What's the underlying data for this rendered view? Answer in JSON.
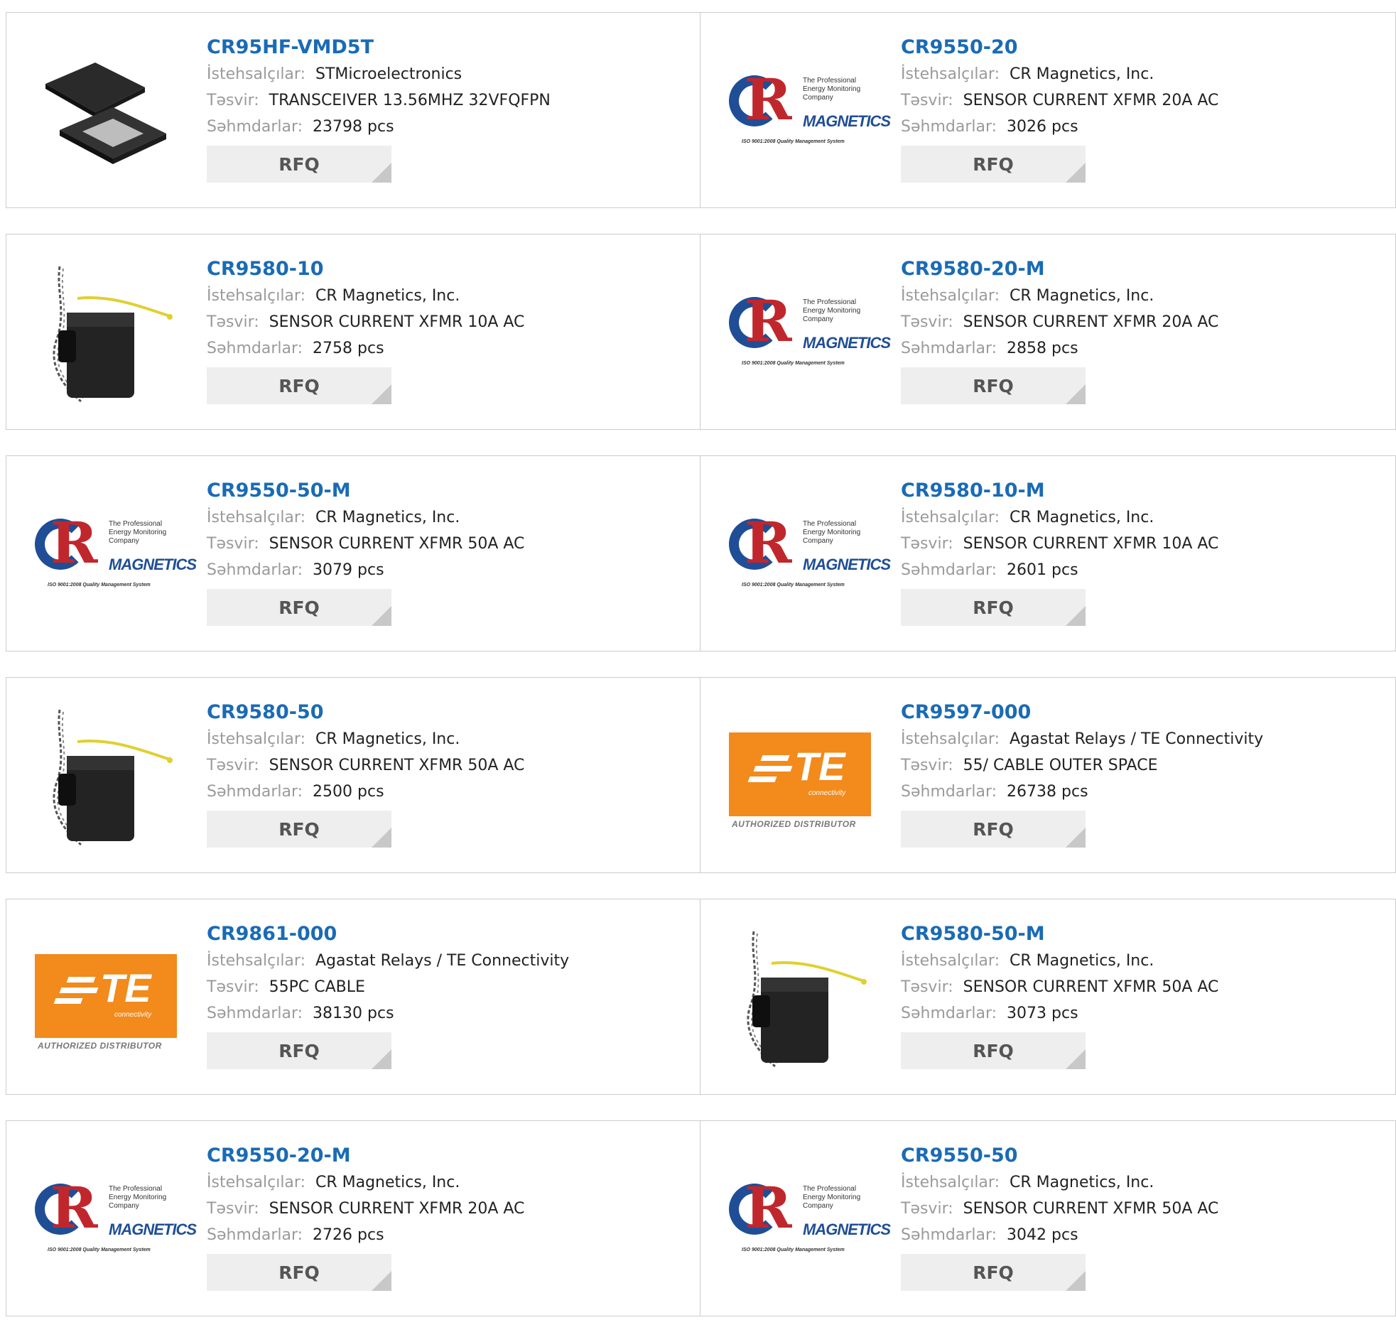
{
  "labels": {
    "manufacturer": "İstehsalçılar:",
    "description": "Təsvir:",
    "stock": "Səhmdarlar:",
    "rfq": "RFQ"
  },
  "logos": {
    "cr": {
      "tagline": "The Professional Energy Monitoring Company",
      "brand": "MAGNETICS",
      "iso": "ISO 9001:2008 Quality Management System"
    },
    "te": {
      "brand": "TE",
      "sub": "connectivity",
      "auth": "AUTHORIZED DISTRIBUTOR"
    }
  },
  "colors": {
    "part_link": "#1a6bb5",
    "label": "#9a9a9a",
    "rfq_bg": "#eeeeee",
    "te_orange": "#f28a1c"
  },
  "products": [
    {
      "part": "CR95HF-VMD5T",
      "manufacturer": "STMicroelectronics",
      "description": "TRANSCEIVER 13.56MHZ 32VFQFPN",
      "stock": "23798 pcs",
      "image": "chip-icon"
    },
    {
      "part": "CR9550-20",
      "manufacturer": "CR Magnetics, Inc.",
      "description": "SENSOR CURRENT XFMR 20A AC",
      "stock": "3026 pcs",
      "image": "cr-logo"
    },
    {
      "part": "CR9580-10",
      "manufacturer": "CR Magnetics, Inc.",
      "description": "SENSOR CURRENT XFMR 10A AC",
      "stock": "2758 pcs",
      "image": "sensor-icon"
    },
    {
      "part": "CR9580-20-M",
      "manufacturer": "CR Magnetics, Inc.",
      "description": "SENSOR CURRENT XFMR 20A AC",
      "stock": "2858 pcs",
      "image": "cr-logo"
    },
    {
      "part": "CR9550-50-M",
      "manufacturer": "CR Magnetics, Inc.",
      "description": "SENSOR CURRENT XFMR 50A AC",
      "stock": "3079 pcs",
      "image": "cr-logo"
    },
    {
      "part": "CR9580-10-M",
      "manufacturer": "CR Magnetics, Inc.",
      "description": "SENSOR CURRENT XFMR 10A AC",
      "stock": "2601 pcs",
      "image": "cr-logo"
    },
    {
      "part": "CR9580-50",
      "manufacturer": "CR Magnetics, Inc.",
      "description": "SENSOR CURRENT XFMR 50A AC",
      "stock": "2500 pcs",
      "image": "sensor-icon"
    },
    {
      "part": "CR9597-000",
      "manufacturer": "Agastat Relays / TE Connectivity",
      "description": "55/ CABLE OUTER SPACE",
      "stock": "26738 pcs",
      "image": "te-logo"
    },
    {
      "part": "CR9861-000",
      "manufacturer": "Agastat Relays / TE Connectivity",
      "description": "55PC CABLE",
      "stock": "38130 pcs",
      "image": "te-logo"
    },
    {
      "part": "CR9580-50-M",
      "manufacturer": "CR Magnetics, Inc.",
      "description": "SENSOR CURRENT XFMR 50A AC",
      "stock": "3073 pcs",
      "image": "sensor-icon"
    },
    {
      "part": "CR9550-20-M",
      "manufacturer": "CR Magnetics, Inc.",
      "description": "SENSOR CURRENT XFMR 20A AC",
      "stock": "2726 pcs",
      "image": "cr-logo"
    },
    {
      "part": "CR9550-50",
      "manufacturer": "CR Magnetics, Inc.",
      "description": "SENSOR CURRENT XFMR 50A AC",
      "stock": "3042 pcs",
      "image": "cr-logo"
    }
  ]
}
